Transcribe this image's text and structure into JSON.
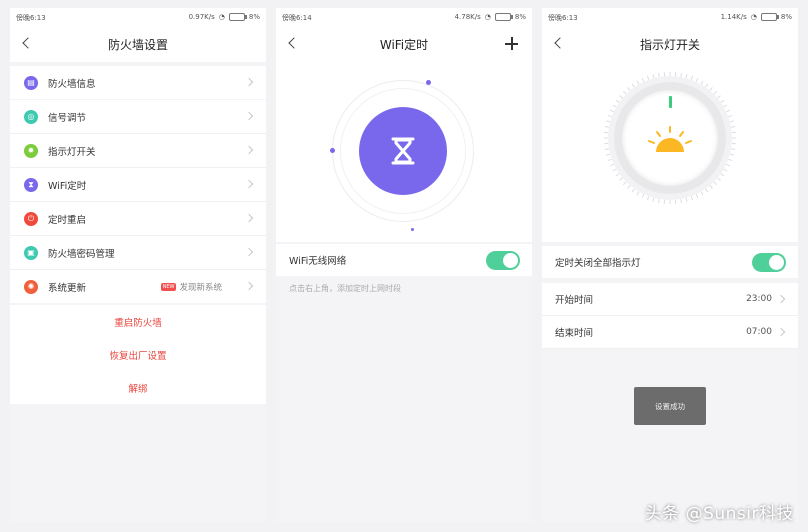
{
  "status": [
    {
      "time": "傍晚6:13",
      "speed": "0.97K/s",
      "battery": "8%"
    },
    {
      "time": "傍晚6:14",
      "speed": "4.78K/s",
      "battery": "8%"
    },
    {
      "time": "傍晚6:13",
      "speed": "1.14K/s",
      "battery": "8%"
    }
  ],
  "screen1": {
    "title": "防火墙设置",
    "info_label": "防火墙信息",
    "items": [
      {
        "label": "信号调节",
        "color": "#3ec9b0"
      },
      {
        "label": "指示灯开关",
        "color": "#7ccc3c"
      },
      {
        "label": "WiFi定时",
        "color": "#7a68ec"
      },
      {
        "label": "定时重启",
        "color": "#ef4a3c"
      },
      {
        "label": "防火墙密码管理",
        "color": "#3ec9b0"
      },
      {
        "label": "系统更新",
        "color": "#f0603c"
      }
    ],
    "update_tag": "NEW",
    "update_text": "发现新系统",
    "actions": [
      "重启防火墙",
      "恢复出厂设置",
      "解绑"
    ]
  },
  "screen2": {
    "title": "WiFi定时",
    "toggle_label": "WiFi无线网络",
    "hint": "点击右上角，添加定时上网时段"
  },
  "screen3": {
    "title": "指示灯开关",
    "toggle_label": "定时关闭全部指示灯",
    "start_label": "开始时间",
    "start_value": "23:00",
    "end_label": "结束时间",
    "end_value": "07:00",
    "toast": "设置成功"
  },
  "watermark": "头条 @Sunsir科技",
  "colors": {
    "accent_purple": "#7a68ec",
    "toggle_green": "#4fcf9a",
    "danger_red": "#e8453c"
  }
}
